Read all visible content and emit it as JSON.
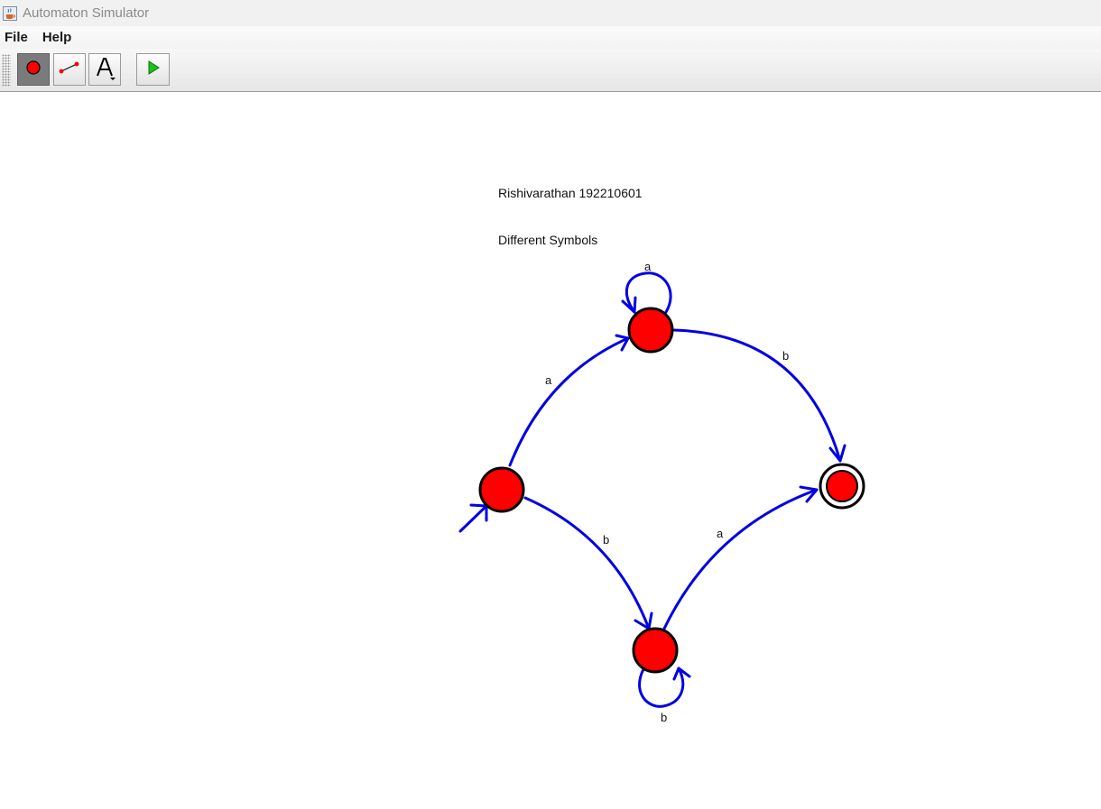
{
  "window": {
    "title": "Automaton Simulator",
    "icon": "java-cup-icon"
  },
  "menubar": {
    "items": [
      "File",
      "Help"
    ]
  },
  "toolbar": {
    "tools": [
      {
        "name": "state-tool",
        "icon": "red-circle-icon",
        "pressed": true
      },
      {
        "name": "transition-tool",
        "icon": "edge-line-icon",
        "pressed": false
      },
      {
        "name": "text-tool",
        "icon": "text-a-icon",
        "pressed": false
      },
      {
        "name": "run-button",
        "icon": "play-icon",
        "pressed": false
      }
    ]
  },
  "canvas": {
    "labels": {
      "author": "Rishivarathan 192210601",
      "description": "Different Symbols"
    },
    "automaton": {
      "states": [
        "q0",
        "q1",
        "q2",
        "q3"
      ],
      "start_state": "q0",
      "accept_states": [
        "q3"
      ],
      "transitions": [
        {
          "from": "q0",
          "to": "q1",
          "symbol": "a"
        },
        {
          "from": "q1",
          "to": "q1",
          "symbol": "a"
        },
        {
          "from": "q1",
          "to": "q3",
          "symbol": "b"
        },
        {
          "from": "q0",
          "to": "q2",
          "symbol": "b"
        },
        {
          "from": "q2",
          "to": "q2",
          "symbol": "b"
        },
        {
          "from": "q2",
          "to": "q3",
          "symbol": "a"
        }
      ]
    },
    "colors": {
      "state_fill": "#ff0000",
      "edge": "#0000e6",
      "outline": "#000000"
    }
  }
}
